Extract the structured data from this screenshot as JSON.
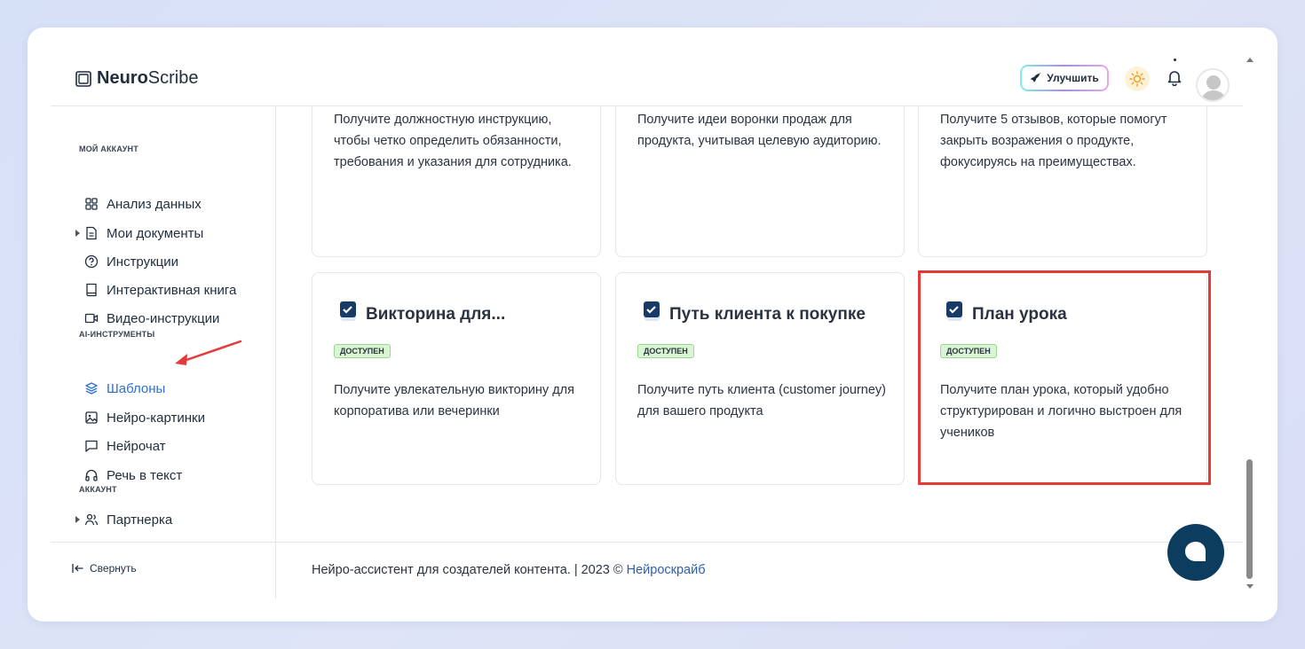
{
  "app": {
    "logo_bold": "Neuro",
    "logo_regular": "Scribe"
  },
  "header": {
    "upgrade_label": "Улучшить"
  },
  "sidebar": {
    "sections": [
      {
        "label": "МОЙ АККАУНТ"
      },
      {
        "label": "AI-ИНСТРУМЕНТЫ"
      },
      {
        "label": "АККАУНТ"
      }
    ],
    "items": [
      {
        "label": "Анализ данных",
        "icon": "grid-icon"
      },
      {
        "label": "Мои документы",
        "icon": "document-icon"
      },
      {
        "label": "Инструкции",
        "icon": "help-circle-icon"
      },
      {
        "label": "Интерактивная книга",
        "icon": "book-icon"
      },
      {
        "label": "Видео-инструкции",
        "icon": "video-icon"
      },
      {
        "label": "Шаблоны",
        "icon": "layers-icon"
      },
      {
        "label": "Нейро-картинки",
        "icon": "image-icon"
      },
      {
        "label": "Нейрочат",
        "icon": "chat-icon"
      },
      {
        "label": "Речь в текст",
        "icon": "headphones-icon"
      },
      {
        "label": "Партнерка",
        "icon": "users-icon"
      }
    ],
    "collapse_label": "Свернуть"
  },
  "cards_top": [
    {
      "desc": "Получите должностную инструкцию, чтобы четко определить обязанности, требования и указания для сотрудника."
    },
    {
      "desc": "Получите идеи воронки продаж для продукта, учитывая целевую аудиторию."
    },
    {
      "desc": "Получите 5 отзывов, которые помогут закрыть возражения о продукте, фокусируясь на преимуществах."
    }
  ],
  "cards": [
    {
      "title": "Викторина для...",
      "badge": "ДОСТУПЕН",
      "desc": "Получите увлекательную викторину для корпоратива или вечеринки"
    },
    {
      "title": "Путь клиента к покупке",
      "badge": "ДОСТУПЕН",
      "desc": "Получите путь клиента (customer journey) для вашего продукта"
    },
    {
      "title": "План урока",
      "badge": "ДОСТУПЕН",
      "desc": "Получите план урока, который удобно структурирован и логично выстроен для учеников"
    }
  ],
  "footer": {
    "text": "Нейро-ассистент для создателей контента.  | 2023 © ",
    "link": "Нейроскрайб"
  },
  "colors": {
    "accent": "#2c6fd6",
    "highlight": "#e53a3a",
    "chat_button": "#0c3d5f",
    "badge_bg": "#d9f5d3"
  }
}
